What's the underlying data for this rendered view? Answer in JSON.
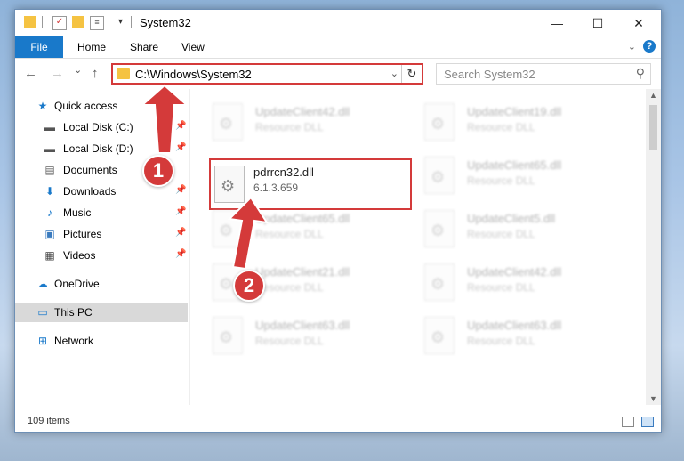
{
  "window": {
    "title": "System32",
    "controls": {
      "minimize": "—",
      "maximize": "☐",
      "close": "✕"
    }
  },
  "ribbon": {
    "file_label": "File",
    "tabs": [
      {
        "label": "Home"
      },
      {
        "label": "Share"
      },
      {
        "label": "View"
      }
    ],
    "help": "?"
  },
  "navigation": {
    "back": "←",
    "forward": "→",
    "recent": "⌄",
    "up": "↑",
    "address": "C:\\Windows\\System32",
    "search_placeholder": "Search System32"
  },
  "sidebar": {
    "items": [
      {
        "label": "Quick access",
        "icon": "star-icon"
      },
      {
        "label": "Local Disk (C:)",
        "icon": "drive-icon"
      },
      {
        "label": "Local Disk (D:)",
        "icon": "drive-icon"
      },
      {
        "label": "Documents",
        "icon": "document-icon"
      },
      {
        "label": "Downloads",
        "icon": "download-icon"
      },
      {
        "label": "Music",
        "icon": "music-icon"
      },
      {
        "label": "Pictures",
        "icon": "pictures-icon"
      },
      {
        "label": "Videos",
        "icon": "videos-icon"
      },
      {
        "label": "OneDrive",
        "icon": "cloud-icon"
      },
      {
        "label": "This PC",
        "icon": "computer-icon"
      },
      {
        "label": "Network",
        "icon": "network-icon"
      }
    ]
  },
  "files": [
    {
      "name": "UpdateClient42.dll",
      "sub": "Resource DLL"
    },
    {
      "name": "UpdateClient19.dll",
      "sub": "Resource DLL"
    },
    {
      "name": "pdrrcn32.dll",
      "sub": "6.1.3.659"
    },
    {
      "name": "UpdateClient65.dll",
      "sub": "Resource DLL"
    },
    {
      "name": "UpdateClient65.dll",
      "sub": "Resource DLL"
    },
    {
      "name": "UpdateClient5.dll",
      "sub": "Resource DLL"
    },
    {
      "name": "UpdateClient21.dll",
      "sub": "Resource DLL"
    },
    {
      "name": "UpdateClient42.dll",
      "sub": "Resource DLL"
    },
    {
      "name": "UpdateClient63.dll",
      "sub": "Resource DLL"
    },
    {
      "name": "UpdateClient63.dll",
      "sub": "Resource DLL"
    }
  ],
  "status": {
    "item_count": "109 items"
  },
  "annotations": {
    "marker1": "1",
    "marker2": "2",
    "color": "#d43a3a"
  }
}
